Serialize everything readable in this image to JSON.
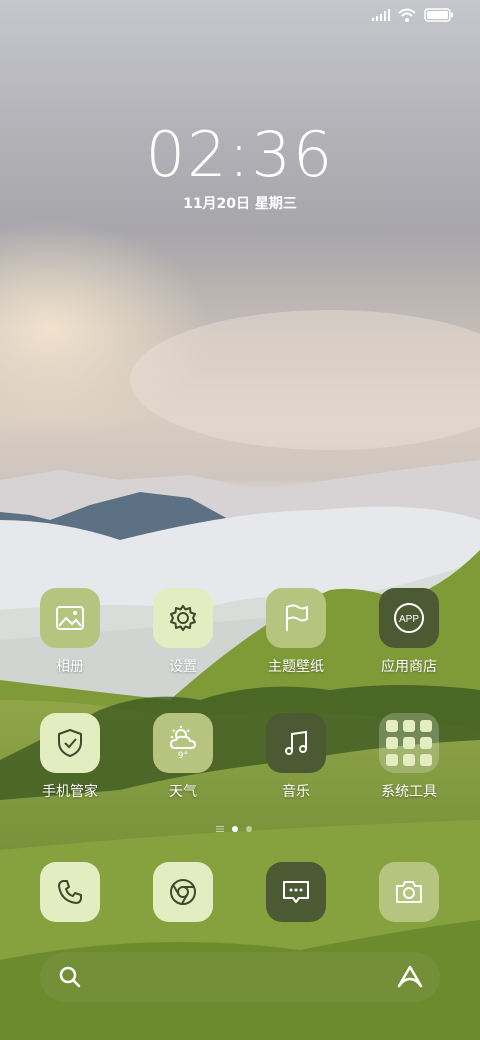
{
  "clock": {
    "time": "02:36",
    "date": "11月20日 星期三"
  },
  "status_bar": {
    "icons": [
      "signal-icon",
      "wifi-icon",
      "battery-icon"
    ]
  },
  "home_apps": [
    {
      "label": "相册",
      "icon": "gallery-icon"
    },
    {
      "label": "设置",
      "icon": "gear-icon"
    },
    {
      "label": "主题壁纸",
      "icon": "flag-icon"
    },
    {
      "label": "应用商店",
      "icon": "app-store-icon",
      "badge_text": "APP"
    },
    {
      "label": "手机管家",
      "icon": "shield-check-icon"
    },
    {
      "label": "天气",
      "icon": "weather-icon",
      "temperature": "9°"
    },
    {
      "label": "音乐",
      "icon": "music-note-icon"
    },
    {
      "label": "系统工具",
      "icon": "folder-icon"
    }
  ],
  "page_indicator": {
    "pages": 2,
    "current": 1
  },
  "dock": [
    {
      "name": "phone",
      "icon": "phone-icon"
    },
    {
      "name": "browser",
      "icon": "browser-icon"
    },
    {
      "name": "messages",
      "icon": "message-icon"
    },
    {
      "name": "camera",
      "icon": "camera-icon"
    }
  ],
  "bottom_bar": {
    "left_icon": "search-icon",
    "right_icon": "assistant-icon"
  },
  "colors": {
    "icon_light": "#e4ecc1",
    "icon_mid": "#b6c480",
    "icon_dark": "#4c5a33",
    "glyph": "#3f4a2a"
  }
}
